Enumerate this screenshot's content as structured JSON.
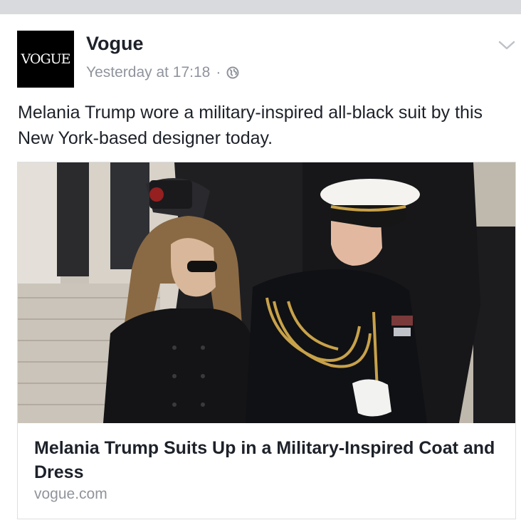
{
  "post": {
    "page_name": "Vogue",
    "avatar_text": "VOGUE",
    "timestamp": "Yesterday at 17:18",
    "separator": "·",
    "privacy_icon": "globe-icon",
    "menu_icon": "chevron-down-icon",
    "caption": "Melania Trump wore a military-inspired all-black suit by this New York-based designer today."
  },
  "link_card": {
    "title": "Melania Trump Suits Up in a Military-Inspired Coat and Dress",
    "domain": "vogue.com"
  },
  "colors": {
    "primary_text": "#1d2129",
    "secondary_text": "#90949c",
    "border": "#dddfe2",
    "top_strip": "#d9dadd"
  }
}
